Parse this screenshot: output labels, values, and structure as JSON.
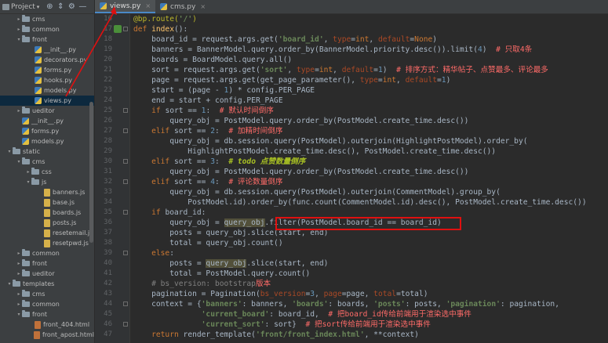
{
  "toolbar": {
    "project_label": "Project",
    "caret": "▾",
    "tools": [
      "⊕",
      "⇕",
      "⚙",
      "—"
    ]
  },
  "tree": [
    {
      "label": "cms",
      "type": "folder",
      "arrow": "▸"
    },
    {
      "label": "common",
      "type": "folder",
      "arrow": "▸"
    },
    {
      "label": "front",
      "type": "folder",
      "arrow": "▾"
    },
    {
      "label": "__init__.py",
      "type": "py"
    },
    {
      "label": "decorators.py",
      "type": "py"
    },
    {
      "label": "forms.py",
      "type": "py"
    },
    {
      "label": "hooks.py",
      "type": "py"
    },
    {
      "label": "models.py",
      "type": "py"
    },
    {
      "label": "views.py",
      "type": "py",
      "selected": true
    },
    {
      "label": "ueditor",
      "type": "folder",
      "arrow": "▸"
    },
    {
      "label": "__init__.py",
      "type": "py"
    },
    {
      "label": "forms.py",
      "type": "py"
    },
    {
      "label": "models.py",
      "type": "py"
    },
    {
      "label": "static",
      "type": "folder",
      "arrow": "▾"
    },
    {
      "label": "cms",
      "type": "folder",
      "arrow": "▾"
    },
    {
      "label": "css",
      "type": "folder",
      "arrow": "▸"
    },
    {
      "label": "js",
      "type": "folder",
      "arrow": "▾"
    },
    {
      "label": "banners.js",
      "type": "js"
    },
    {
      "label": "base.js",
      "type": "js"
    },
    {
      "label": "boards.js",
      "type": "js"
    },
    {
      "label": "posts.js",
      "type": "js"
    },
    {
      "label": "resetemail.js",
      "type": "js"
    },
    {
      "label": "resetpwd.js",
      "type": "js"
    },
    {
      "label": "common",
      "type": "folder",
      "arrow": "▸"
    },
    {
      "label": "front",
      "type": "folder",
      "arrow": "▸"
    },
    {
      "label": "ueditor",
      "type": "folder",
      "arrow": "▸"
    },
    {
      "label": "templates",
      "type": "folder",
      "arrow": "▾"
    },
    {
      "label": "cms",
      "type": "folder",
      "arrow": "▸"
    },
    {
      "label": "common",
      "type": "folder",
      "arrow": "▸"
    },
    {
      "label": "front",
      "type": "folder",
      "arrow": "▾"
    },
    {
      "label": "front_404.html",
      "type": "html"
    },
    {
      "label": "front_apost.html",
      "type": "html"
    }
  ],
  "tabs": [
    {
      "label": "views.py",
      "active": true,
      "close": "×"
    },
    {
      "label": "cms.py",
      "active": false,
      "close": "×"
    }
  ],
  "line_numbers": [
    "16",
    "17",
    "18",
    "19",
    "20",
    "21",
    "22",
    "23",
    "24",
    "25",
    "26",
    "27",
    "28",
    "29",
    "30",
    "31",
    "32",
    "33",
    "34",
    "35",
    "36",
    "37",
    "38",
    "39",
    "40",
    "41",
    "42",
    "43",
    "44",
    "45",
    "46",
    "47"
  ],
  "code_lines": [
    {
      "t": "d",
      "segs": [
        [
          "dec",
          "@bp.route("
        ],
        [
          "s",
          "'/'"
        ],
        [
          "dec",
          ")"
        ]
      ]
    },
    {
      "t": "d",
      "segs": [
        [
          "kw",
          "def "
        ],
        [
          "fn",
          "index"
        ],
        [
          "",
          "():"
        ]
      ]
    },
    {
      "t": "d",
      "segs": [
        [
          "",
          "    board_id = request.args.get("
        ],
        [
          "s",
          "'board_id'"
        ],
        [
          "",
          ", "
        ],
        [
          "kp",
          "type"
        ],
        [
          "",
          "="
        ],
        [
          "kw",
          "int"
        ],
        [
          "",
          ", "
        ],
        [
          "kp",
          "default"
        ],
        [
          "",
          "="
        ],
        [
          "kw",
          "None"
        ],
        [
          "",
          ")"
        ]
      ]
    },
    {
      "t": "d",
      "segs": [
        [
          "",
          "    banners = BannerModel.query.order_by(BannerModel.priority.desc()).limit("
        ],
        [
          "n",
          "4"
        ],
        [
          "",
          ")  "
        ],
        [
          "cz",
          "# 只取4条"
        ]
      ]
    },
    {
      "t": "d",
      "segs": [
        [
          "",
          "    boards = BoardModel.query.all()"
        ]
      ]
    },
    {
      "t": "d",
      "segs": [
        [
          "",
          "    sort = request.args.get("
        ],
        [
          "s",
          "'sort'"
        ],
        [
          "",
          ", "
        ],
        [
          "kp",
          "type"
        ],
        [
          "",
          "="
        ],
        [
          "kw",
          "int"
        ],
        [
          "",
          ", "
        ],
        [
          "kp",
          "default"
        ],
        [
          "",
          "="
        ],
        [
          "n",
          "1"
        ],
        [
          "",
          ")  "
        ],
        [
          "cz",
          "# 排序方式：精华帖子、点赞最多、评论最多"
        ]
      ]
    },
    {
      "t": "d",
      "segs": [
        [
          "",
          "    page = request.args.get(get_page_parameter(), "
        ],
        [
          "kp",
          "type"
        ],
        [
          "",
          "="
        ],
        [
          "kw",
          "int"
        ],
        [
          "",
          ", "
        ],
        [
          "kp",
          "default"
        ],
        [
          "",
          "="
        ],
        [
          "n",
          "1"
        ],
        [
          "",
          ")"
        ]
      ]
    },
    {
      "t": "d",
      "segs": [
        [
          "",
          "    start = (page - "
        ],
        [
          "n",
          "1"
        ],
        [
          "",
          ") * config.PER_PAGE"
        ]
      ]
    },
    {
      "t": "d",
      "segs": [
        [
          "",
          "    end = start + config.PER_PAGE"
        ]
      ]
    },
    {
      "t": "d",
      "segs": [
        [
          "",
          "    "
        ],
        [
          "kw",
          "if "
        ],
        [
          "",
          "sort == "
        ],
        [
          "n",
          "1"
        ],
        [
          "",
          ":  "
        ],
        [
          "cz",
          "# 默认时间倒序"
        ]
      ]
    },
    {
      "t": "d",
      "segs": [
        [
          "",
          "        query_obj = PostModel.query.order_by(PostModel.create_time.desc())"
        ]
      ]
    },
    {
      "t": "d",
      "segs": [
        [
          "",
          "    "
        ],
        [
          "kw",
          "elif "
        ],
        [
          "",
          "sort == "
        ],
        [
          "n",
          "2"
        ],
        [
          "",
          ":  "
        ],
        [
          "cz",
          "# 加精时间倒序"
        ]
      ]
    },
    {
      "t": "d",
      "segs": [
        [
          "",
          "        query_obj = db.session.query(PostModel).outerjoin(HighlightPostModel).order_by("
        ]
      ]
    },
    {
      "t": "d",
      "segs": [
        [
          "",
          "            HighlightPostModel.create_time.desc(), PostModel.create_time.desc())"
        ]
      ]
    },
    {
      "t": "d",
      "segs": [
        [
          "",
          "    "
        ],
        [
          "kw",
          "elif "
        ],
        [
          "",
          "sort == "
        ],
        [
          "n",
          "3"
        ],
        [
          "",
          ":  "
        ],
        [
          "todo",
          "# todo 点赞数量倒序"
        ]
      ]
    },
    {
      "t": "d",
      "segs": [
        [
          "",
          "        query_obj = PostModel.query.order_by(PostModel.create_time.desc())"
        ]
      ]
    },
    {
      "t": "d",
      "segs": [
        [
          "",
          "    "
        ],
        [
          "kw",
          "elif "
        ],
        [
          "",
          "sort == "
        ],
        [
          "n",
          "4"
        ],
        [
          "",
          ":  "
        ],
        [
          "cz",
          "# 评论数量倒序"
        ]
      ]
    },
    {
      "t": "d",
      "segs": [
        [
          "",
          "        query_obj = db.session.query(PostModel).outerjoin(CommentModel).group_by("
        ]
      ]
    },
    {
      "t": "d",
      "segs": [
        [
          "",
          "            PostModel.id).order_by(func.count(CommentModel.id).desc(), PostModel.create_time.desc())"
        ]
      ]
    },
    {
      "t": "d",
      "segs": [
        [
          "",
          "    "
        ],
        [
          "kw",
          "if "
        ],
        [
          "",
          "board_id:"
        ]
      ]
    },
    {
      "t": "d",
      "segs": [
        [
          "",
          "        query_obj = "
        ],
        [
          "hl",
          "query_obj"
        ],
        [
          "",
          ".filter(PostModel.board_id == board_id)"
        ]
      ]
    },
    {
      "t": "d",
      "segs": [
        [
          "",
          "        posts = query_obj.slice(start, end)"
        ]
      ]
    },
    {
      "t": "d",
      "segs": [
        [
          "",
          "        total = query_obj.count()"
        ]
      ]
    },
    {
      "t": "d",
      "segs": [
        [
          "",
          "    "
        ],
        [
          "kw",
          "else"
        ],
        [
          "",
          ":"
        ]
      ]
    },
    {
      "t": "d",
      "segs": [
        [
          "",
          "        posts = "
        ],
        [
          "hl",
          "query_obj"
        ],
        [
          "",
          ".slice(start, end)"
        ]
      ]
    },
    {
      "t": "d",
      "segs": [
        [
          "",
          "        total = PostModel.query.count()"
        ]
      ]
    },
    {
      "t": "d",
      "segs": [
        [
          "",
          "    "
        ],
        [
          "c",
          "# bs_version: bootstrap"
        ],
        [
          "cz",
          "版本"
        ]
      ]
    },
    {
      "t": "d",
      "segs": [
        [
          "",
          "    pagination = Pagination("
        ],
        [
          "kp",
          "bs_version"
        ],
        [
          "",
          "="
        ],
        [
          "n",
          "3"
        ],
        [
          "",
          ", "
        ],
        [
          "kp",
          "page"
        ],
        [
          "",
          "=page, "
        ],
        [
          "kp",
          "total"
        ],
        [
          "",
          "=total)"
        ]
      ]
    },
    {
      "t": "d",
      "segs": [
        [
          "",
          "    context = {"
        ],
        [
          "s",
          "'banners'"
        ],
        [
          "",
          ": banners, "
        ],
        [
          "s",
          "'boards'"
        ],
        [
          "",
          ": boards, "
        ],
        [
          "s",
          "'posts'"
        ],
        [
          "",
          ": posts, "
        ],
        [
          "s",
          "'pagination'"
        ],
        [
          "",
          ": pagination,"
        ]
      ]
    },
    {
      "t": "d",
      "segs": [
        [
          "",
          "               "
        ],
        [
          "s",
          "'current_board'"
        ],
        [
          "",
          ": board_id,  "
        ],
        [
          "cz",
          "# 把board_id传给前端用于渲染选中事件"
        ]
      ]
    },
    {
      "t": "d",
      "segs": [
        [
          "",
          "               "
        ],
        [
          "s",
          "'current_sort'"
        ],
        [
          "",
          ": sort}  "
        ],
        [
          "cz",
          "# 把sort传给前端用于渲染选中事件"
        ]
      ]
    },
    {
      "t": "d",
      "segs": [
        [
          "",
          "    "
        ],
        [
          "kw",
          "return "
        ],
        [
          "",
          "render_template("
        ],
        [
          "s",
          "'front/front_index.html'"
        ],
        [
          "",
          ", **context)"
        ]
      ]
    }
  ]
}
